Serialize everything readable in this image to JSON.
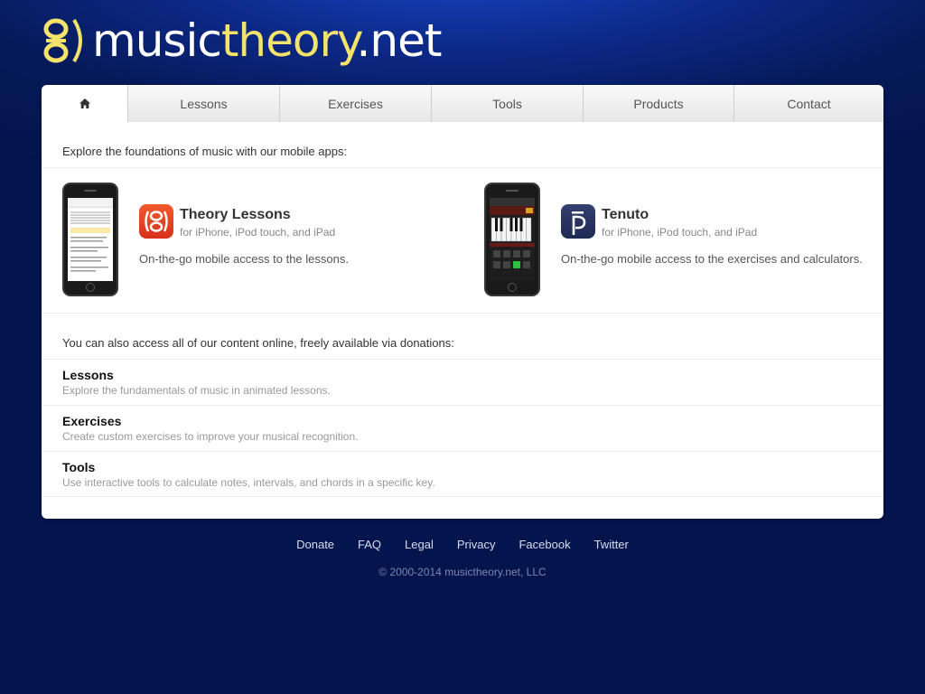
{
  "header": {
    "logo_part1": "music",
    "logo_part2": "theory",
    "logo_part3": ".net"
  },
  "nav": {
    "home_icon": "home-icon",
    "tabs": [
      "Lessons",
      "Exercises",
      "Tools",
      "Products",
      "Contact"
    ]
  },
  "intro": "Explore the foundations of music with our mobile apps:",
  "apps": [
    {
      "title": "Theory Lessons",
      "subtitle": "for iPhone, iPod touch, and iPad",
      "desc": "On-the-go mobile access to the lessons.",
      "icon": "theory-lessons-app-icon",
      "icon_color": "#e8401c"
    },
    {
      "title": "Tenuto",
      "subtitle": "for iPhone, iPod touch, and iPad",
      "desc": "On-the-go mobile access to the exercises and calculators.",
      "icon": "tenuto-app-icon",
      "icon_color": "#26345e"
    }
  ],
  "online_intro": "You can also access all of our content online, freely available via donations:",
  "sections": [
    {
      "title": "Lessons",
      "desc": "Explore the fundamentals of music in animated lessons."
    },
    {
      "title": "Exercises",
      "desc": "Create custom exercises to improve your musical recognition."
    },
    {
      "title": "Tools",
      "desc": "Use interactive tools to calculate notes, intervals, and chords in a specific key."
    }
  ],
  "footer": {
    "links": [
      "Donate",
      "FAQ",
      "Legal",
      "Privacy",
      "Facebook",
      "Twitter"
    ],
    "copyright": "© 2000-2014 musictheory.net, LLC"
  },
  "colors": {
    "background": "#04154d",
    "logo_yellow": "#f3e36a"
  }
}
